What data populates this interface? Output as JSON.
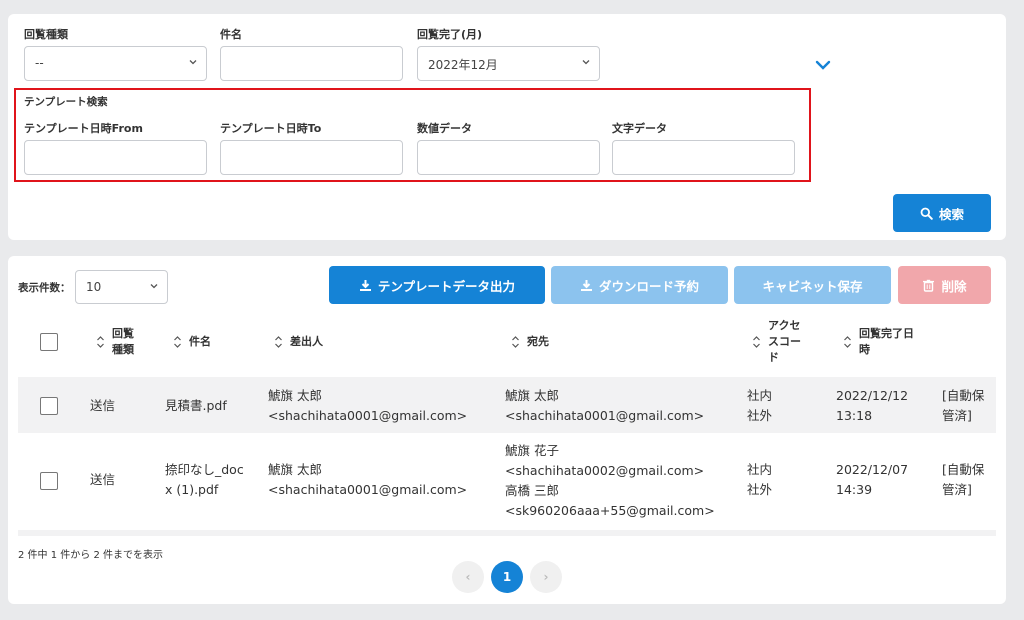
{
  "filters": {
    "type_label": "回覧種類",
    "type_value": "--",
    "subject_label": "件名",
    "subject_value": "",
    "completed_label": "回覧完了(月)",
    "completed_value": "2022年12月"
  },
  "template_search": {
    "title": "テンプレート検索",
    "from_label": "テンプレート日時From",
    "to_label": "テンプレート日時To",
    "numeric_label": "数値データ",
    "text_label": "文字データ"
  },
  "search_button": "検索",
  "toolbar": {
    "page_size_label": "表示件数：",
    "page_size_value": "10",
    "export_template": "テンプレートデータ出力",
    "download_reserve": "ダウンロード予約",
    "cabinet_save": "キャビネット保存",
    "delete": "削除"
  },
  "table": {
    "headers": [
      "回覧\n種類",
      "件名",
      "差出人",
      "宛先",
      "アクセ\nスコー\nド",
      "回覧完了日\n時"
    ],
    "rows": [
      {
        "type": "送信",
        "subject": "見積書.pdf",
        "sender": "鯱旗 太郎\n<shachihata0001@gmail.com>",
        "recipients": "鯱旗 太郎\n<shachihata0001@gmail.com>",
        "access": "社内\n社外",
        "completed": "2022/12/12\n13:18",
        "status": "[自動保\n管済]"
      },
      {
        "type": "送信",
        "subject": "捺印なし_doc\nx (1).pdf",
        "sender": "鯱旗 太郎\n<shachihata0001@gmail.com>",
        "recipients": "鯱旗 花子\n<shachihata0002@gmail.com>\n高橋 三郎\n<sk960206aaa+55@gmail.com>",
        "access": "社内\n社外",
        "completed": "2022/12/07\n14:39",
        "status": "[自動保\n管済]"
      }
    ]
  },
  "summary": "2 件中 1 件から 2 件までを表示",
  "pagination": {
    "current": "1",
    "prev": "‹",
    "next": "›"
  },
  "colors": {
    "primary": "#1583d6",
    "primary_disabled": "#8cc3ee",
    "danger_disabled": "#f1a7ab",
    "highlight": "#e0141b"
  }
}
